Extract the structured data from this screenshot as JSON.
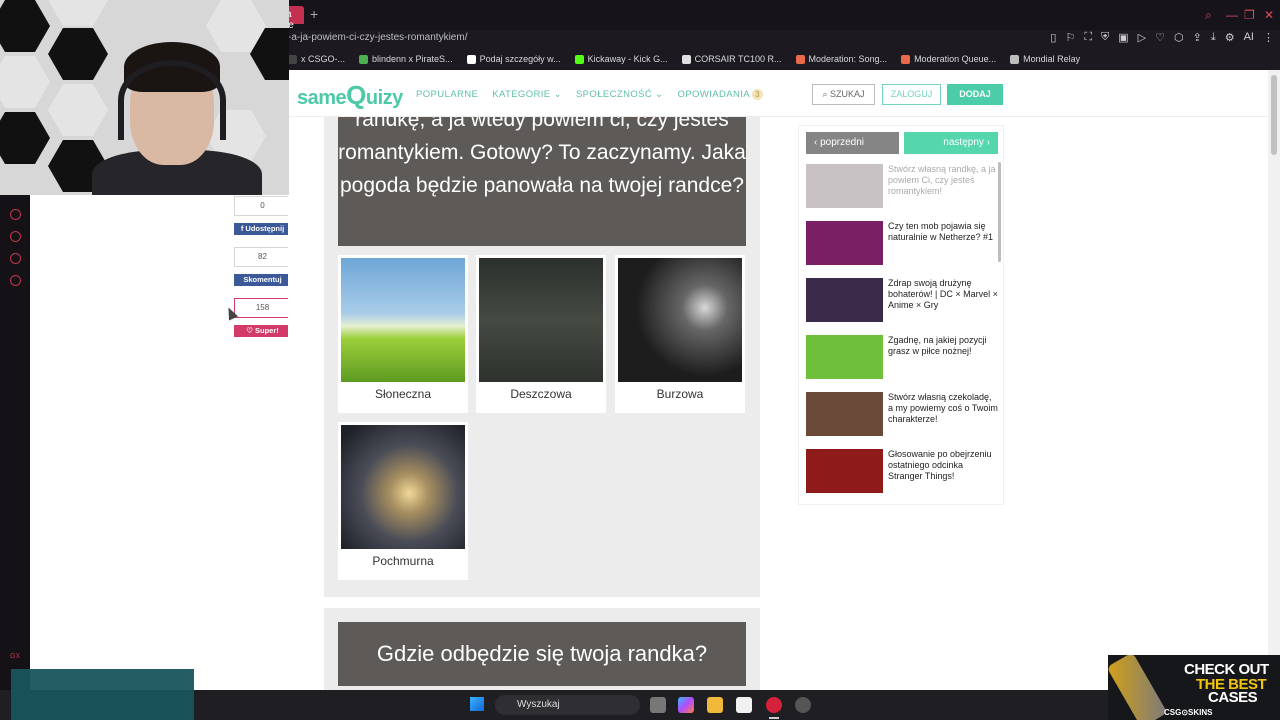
{
  "browser": {
    "active_tab_label": "a je",
    "new_tab_symbol": "+",
    "url": "-a-ja-powiem-ci-czy-jestes-romantykiem/",
    "bookmarks": [
      {
        "label": "x CSGO-...",
        "color": "#444444"
      },
      {
        "label": "blindenn x PirateS...",
        "color": "#4caf50"
      },
      {
        "label": "Podaj szczegóły w...",
        "color": "#ffffff"
      },
      {
        "label": "Kickaway - Kick G...",
        "color": "#53fc18"
      },
      {
        "label": "CORSAIR TC100 R...",
        "color": "#e0e0e0"
      },
      {
        "label": "Moderation: Song...",
        "color": "#e86a4b"
      },
      {
        "label": "Moderation Queue...",
        "color": "#e86a4b"
      },
      {
        "label": "Mondial Relay",
        "color": "#bdbdbd"
      }
    ],
    "toolbar_ai_label": "AI"
  },
  "site": {
    "logo_prefix": "same",
    "logo_q": "Q",
    "logo_suffix": "uizy",
    "nav": {
      "popular": "POPULARNE",
      "categories": "KATEGORIE ⌄",
      "community": "SPOŁECZNOŚĆ ⌄",
      "stories": "OPOWIADANIA",
      "stories_badge": "3"
    },
    "search_button": "SZUKAJ",
    "login_button": "ZALOGUJ",
    "add_button": "DODAJ"
  },
  "question1": {
    "text": "randkę, a ja wtedy powiem ci, czy jesteś romantykiem. Gotowy? To zaczynamy. Jaka pogoda będzie panowała na twojej randce?",
    "answers": [
      {
        "label": "Słoneczna"
      },
      {
        "label": "Deszczowa"
      },
      {
        "label": "Burzowa"
      },
      {
        "label": "Pochmurna"
      }
    ]
  },
  "question2": {
    "text": "Gdzie odbędzie się twoja randka?"
  },
  "share": {
    "share_count": "0",
    "share_label": "Udostępnij",
    "comment_count": "82",
    "comment_label": "Skomentuj",
    "super_count": "158",
    "super_label": "Super!"
  },
  "right_panel": {
    "prev_label": "poprzedni",
    "next_label": "następny",
    "items": [
      {
        "title": "Stwórz własną randkę, a ja powiem Ci, czy jesteś romantykiem!",
        "thumb_color": "#c8c2c4"
      },
      {
        "title": "Czy ten mob pojawia się naturalnie w Netherze? #1",
        "thumb_color": "#7a1f63"
      },
      {
        "title": "Zdrap swoją drużynę bohaterów! | DC × Marvel × Anime × Gry",
        "thumb_color": "#3b2a4a"
      },
      {
        "title": "Zgadnę, na jakiej pozycji grasz w piłce nożnej!",
        "thumb_color": "#6fbf3a"
      },
      {
        "title": "Stwórz własną czekoladę, a my powiemy coś o Twoim charakterze!",
        "thumb_color": "#6b4a3a"
      },
      {
        "title": "Głosowanie po obejrzeniu ostatniego odcinka Stranger Things!",
        "thumb_color": "#8e1a1a"
      }
    ]
  },
  "taskbar": {
    "search_label": "Wyszukaj"
  },
  "ad": {
    "line1": "CHECK OUT",
    "line2": "THE BEST",
    "line3": "CASES",
    "brand": "CSG⊙SKINS"
  },
  "sidebar_gx": "GX",
  "colors": {
    "accent": "#4ccca8",
    "question_bg": "#5e5a58",
    "opera_red": "#c4344a"
  }
}
